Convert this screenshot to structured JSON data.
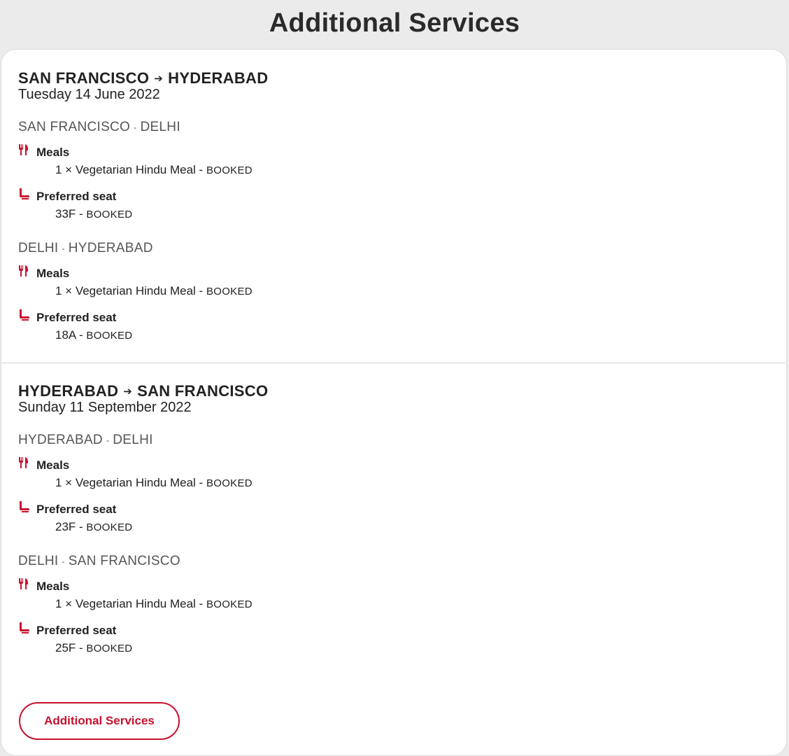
{
  "page_title": "Additional Services",
  "icons": {
    "meal": "fork-knife-icon",
    "seat": "seat-icon",
    "accent": "#c8102e"
  },
  "trips": [
    {
      "origin": "SAN FRANCISCO",
      "destination": "HYDERABAD",
      "date": "Tuesday 14 June 2022",
      "segments": [
        {
          "from": "SAN FRANCISCO",
          "to": "DELHI",
          "meals_label": "Meals",
          "meal_detail": "1 × Vegetarian Hindu Meal - ",
          "meal_status": "BOOKED",
          "seat_label": "Preferred seat",
          "seat_detail": "33F - ",
          "seat_status": "BOOKED"
        },
        {
          "from": "DELHI",
          "to": "HYDERABAD",
          "meals_label": "Meals",
          "meal_detail": "1 × Vegetarian Hindu Meal - ",
          "meal_status": "BOOKED",
          "seat_label": "Preferred seat",
          "seat_detail": "18A - ",
          "seat_status": "BOOKED"
        }
      ]
    },
    {
      "origin": "HYDERABAD",
      "destination": "SAN FRANCISCO",
      "date": "Sunday 11 September 2022",
      "segments": [
        {
          "from": "HYDERABAD",
          "to": "DELHI",
          "meals_label": "Meals",
          "meal_detail": "1 × Vegetarian Hindu Meal - ",
          "meal_status": "BOOKED",
          "seat_label": "Preferred seat",
          "seat_detail": "23F - ",
          "seat_status": "BOOKED"
        },
        {
          "from": "DELHI",
          "to": "SAN FRANCISCO",
          "meals_label": "Meals",
          "meal_detail": "1 × Vegetarian Hindu Meal - ",
          "meal_status": "BOOKED",
          "seat_label": "Preferred seat",
          "seat_detail": "25F - ",
          "seat_status": "BOOKED"
        }
      ]
    }
  ],
  "footer": {
    "button_label": "Additional Services"
  }
}
